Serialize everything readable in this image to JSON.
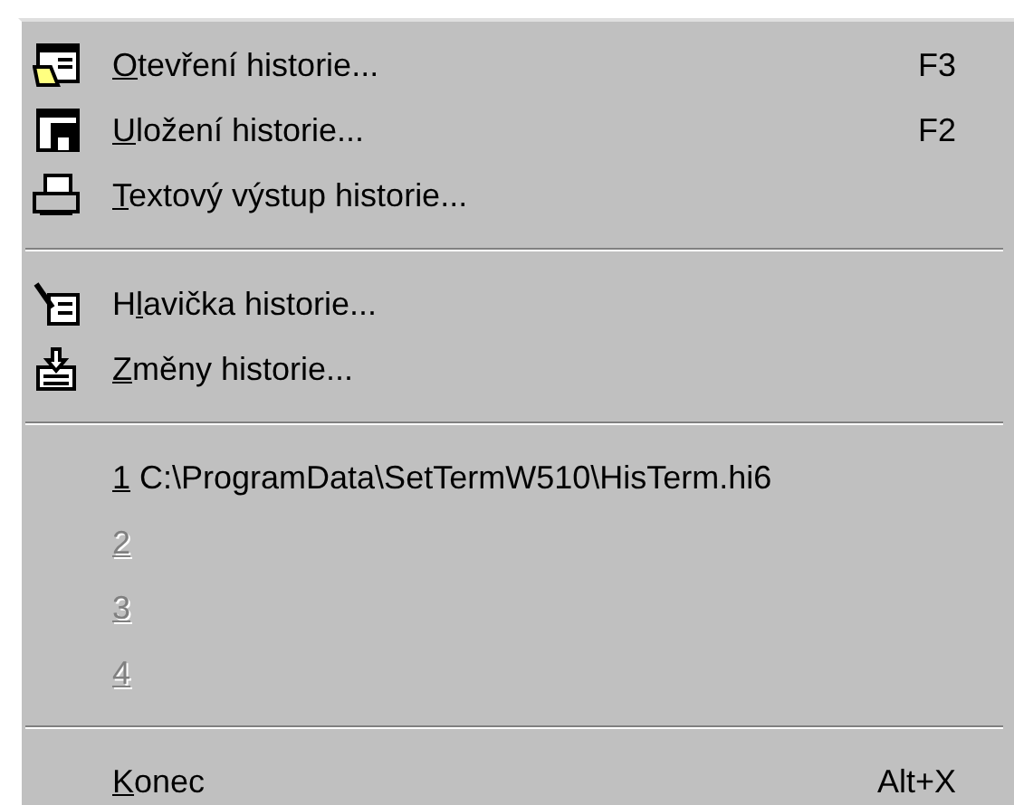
{
  "menu": {
    "groups": [
      {
        "items": [
          {
            "mnemonic": "O",
            "rest": "tevření historie...",
            "shortcut": "F3",
            "disabled": false
          },
          {
            "mnemonic": "U",
            "rest": "ložení historie...",
            "shortcut": "F2",
            "disabled": false
          },
          {
            "mnemonic": "T",
            "rest": "extový výstup historie...",
            "disabled": false
          }
        ]
      },
      {
        "items": [
          {
            "prefix": "H",
            "mnemonic": "l",
            "rest": "avička historie...",
            "disabled": false
          },
          {
            "mnemonic": "Z",
            "rest": "měny historie...",
            "disabled": false
          }
        ]
      },
      {
        "items": [
          {
            "mnemonic": "1",
            "rest": " C:\\ProgramData\\SetTermW510\\HisTerm.hi6",
            "disabled": false
          },
          {
            "mnemonic": "2",
            "disabled": true
          },
          {
            "mnemonic": "3",
            "disabled": true
          },
          {
            "mnemonic": "4",
            "disabled": true
          }
        ]
      },
      {
        "items": [
          {
            "mnemonic": "K",
            "rest": "onec",
            "shortcut": "Alt+X",
            "disabled": false
          }
        ]
      }
    ]
  }
}
